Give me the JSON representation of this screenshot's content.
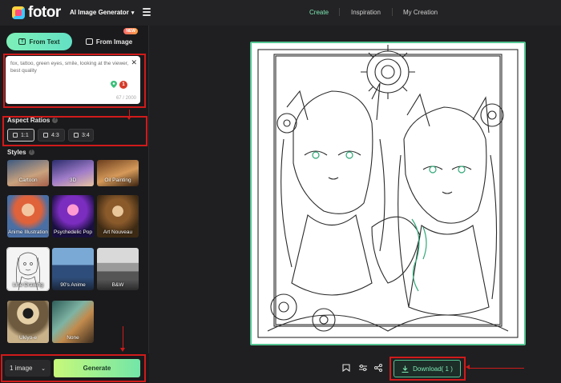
{
  "app": {
    "logo_text": "fotor",
    "generator_label": "AI Image Generator",
    "nav": [
      {
        "label": "Create",
        "active": true
      },
      {
        "label": "Inspiration",
        "active": false
      },
      {
        "label": "My Creation",
        "active": false
      }
    ]
  },
  "mode_tabs": {
    "from_text": "From Text",
    "from_image": "From Image",
    "new_badge": "NEW"
  },
  "prompt": {
    "value": "fox, tattoo, green eyes, smile, looking at the viewer, best quality",
    "char_count": "67 / 2000",
    "ai_badge": "1"
  },
  "aspect_ratios": {
    "title": "Aspect Ratios",
    "options": [
      {
        "label": "1:1",
        "selected": true
      },
      {
        "label": "4:3",
        "selected": false
      },
      {
        "label": "3:4",
        "selected": false
      }
    ]
  },
  "styles": {
    "title": "Styles",
    "items": [
      {
        "label": "Cartoon",
        "selected": false
      },
      {
        "label": "3D",
        "selected": false
      },
      {
        "label": "Oil Painting",
        "selected": false
      },
      {
        "label": "Anime Illustration",
        "selected": false
      },
      {
        "label": "Psychedelic Pop",
        "selected": false
      },
      {
        "label": "Art Nouveau",
        "selected": false
      },
      {
        "label": "Line Drawing",
        "selected": true
      },
      {
        "label": "90's Anime",
        "selected": false
      },
      {
        "label": "B&W",
        "selected": false
      },
      {
        "label": "Ukiyo-e",
        "selected": false
      },
      {
        "label": "None",
        "selected": false
      }
    ]
  },
  "generate": {
    "count_value": "1 image",
    "button_label": "Generate"
  },
  "result": {
    "download_label": "Download( 1 )",
    "tool_icons": [
      "bookmark-icon",
      "adjust-icon",
      "share-icon"
    ]
  },
  "colors": {
    "accent": "#7de9b4",
    "annotation_red": "#d11a1a",
    "background": "#1f1f21"
  }
}
